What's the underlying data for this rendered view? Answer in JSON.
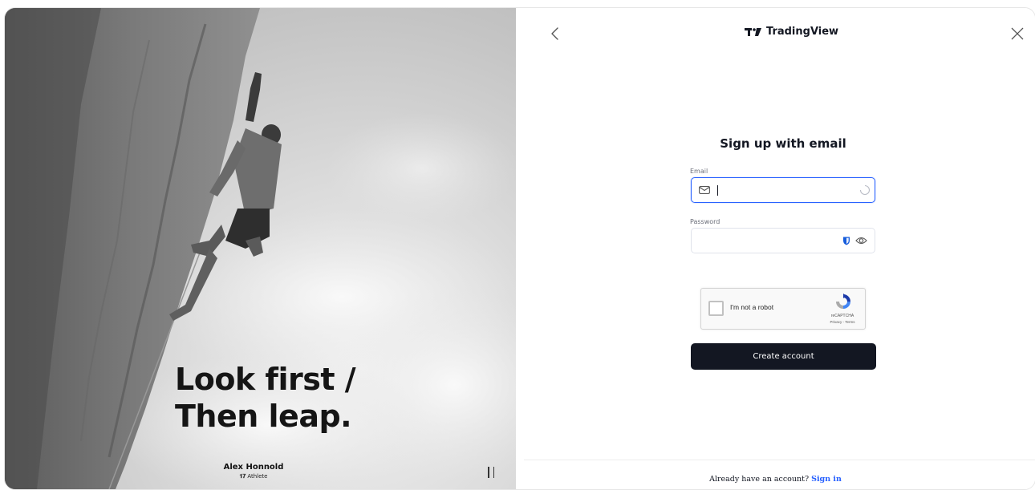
{
  "hero": {
    "headline_line1": "Look first /",
    "headline_line2": "Then leap.",
    "athlete_name": "Alex Honnold",
    "athlete_role": "Athlete",
    "pause_icon": "pause-icon"
  },
  "header": {
    "brand_name": "TradingView",
    "back_icon": "chevron-left-icon",
    "close_icon": "close-icon"
  },
  "form": {
    "title": "Sign up with email",
    "email": {
      "label": "Email",
      "value": "",
      "placeholder": ""
    },
    "password": {
      "label": "Password",
      "value": "",
      "placeholder": ""
    },
    "captcha": {
      "label": "I'm not a robot",
      "brand": "reCAPTCHA",
      "terms": "Privacy - Terms",
      "checked": false
    },
    "submit_label": "Create account"
  },
  "footer": {
    "prompt": "Already have an account?",
    "link": "Sign in"
  },
  "colors": {
    "accent": "#2962ff",
    "button_bg": "#131722",
    "text": "#131722"
  }
}
